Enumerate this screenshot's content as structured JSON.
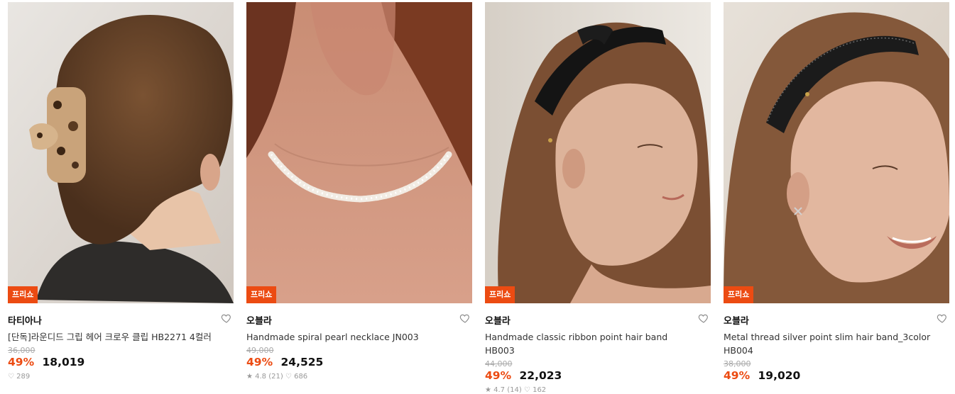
{
  "products": [
    {
      "badge": "프리쇼",
      "brand": "타티아나",
      "name": "[단독]라운디드 그립 헤어 크로우 클립 HB2271 4컬러",
      "original_price": "36,000",
      "discount": "49%",
      "price": "18,019",
      "meta": "♡ 289",
      "image_desc": "tortoiseshell hair claw clip"
    },
    {
      "badge": "프리쇼",
      "brand": "오블라",
      "name": "Handmade spiral pearl necklace JN003",
      "original_price": "49,000",
      "discount": "49%",
      "price": "24,525",
      "meta": "★ 4.8 (21)  ♡ 686",
      "image_desc": "twisted pearl necklace"
    },
    {
      "badge": "프리쇼",
      "brand": "오블라",
      "name": "Handmade classic ribbon point hair band HB003",
      "original_price": "44,000",
      "discount": "49%",
      "price": "22,023",
      "meta": "★ 4.7 (14)  ♡ 162",
      "image_desc": "black ribbon hair band"
    },
    {
      "badge": "프리쇼",
      "brand": "오블라",
      "name": "Metal thread silver point slim hair band_3color HB004",
      "original_price": "38,000",
      "discount": "49%",
      "price": "19,020",
      "meta": "",
      "image_desc": "slim metal thread hair band"
    }
  ],
  "colors": {
    "accent": "#ec4b12",
    "text": "#111111",
    "muted": "#aaaaaa"
  }
}
